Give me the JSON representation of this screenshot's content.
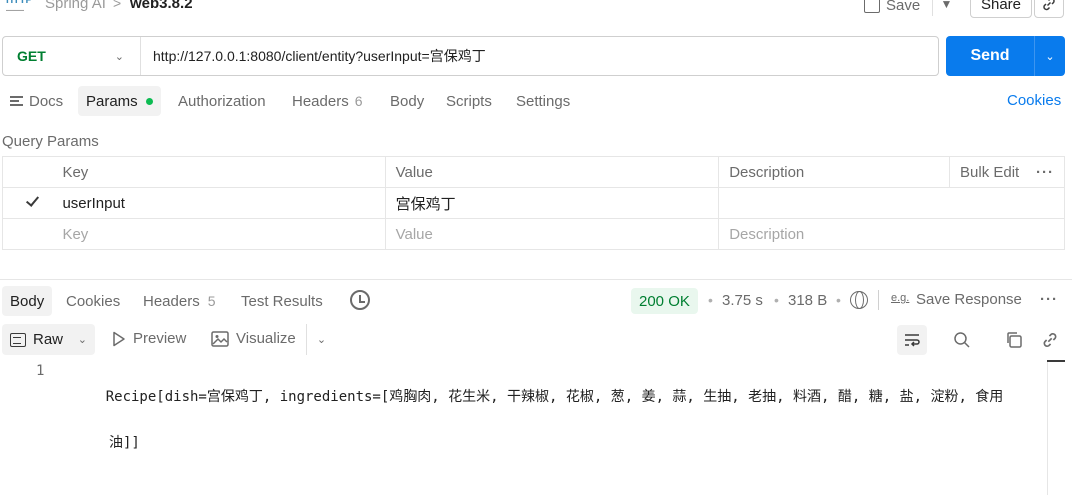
{
  "breadcrumb": {
    "parent": "Spring AI",
    "separator": ">",
    "current": "web3.8.2"
  },
  "header_actions": {
    "save_label": "Save",
    "share_label": "Share"
  },
  "request": {
    "method": "GET",
    "url": "http://127.0.0.1:8080/client/entity?userInput=宫保鸡丁",
    "send_label": "Send"
  },
  "request_tabs": [
    {
      "label": "Docs"
    },
    {
      "label": "Params",
      "active": true
    },
    {
      "label": "Authorization"
    },
    {
      "label": "Headers",
      "count": "6"
    },
    {
      "label": "Body"
    },
    {
      "label": "Scripts"
    },
    {
      "label": "Settings"
    }
  ],
  "cookies_link": "Cookies",
  "query_params": {
    "title": "Query Params",
    "columns": [
      "Key",
      "Value",
      "Description"
    ],
    "bulk_edit": "Bulk Edit",
    "rows": [
      {
        "checked": true,
        "key": "userInput",
        "value": "宫保鸡丁",
        "description": ""
      }
    ],
    "placeholder": {
      "key": "Key",
      "value": "Value",
      "description": "Description"
    }
  },
  "response_tabs": [
    {
      "label": "Body",
      "active": true
    },
    {
      "label": "Cookies"
    },
    {
      "label": "Headers",
      "count": "5"
    },
    {
      "label": "Test Results"
    }
  ],
  "response_meta": {
    "status": "200 OK",
    "time": "3.75 s",
    "size": "318 B",
    "save_response": "Save Response"
  },
  "response_toolbar": {
    "format": "Raw",
    "preview": "Preview",
    "visualize": "Visualize"
  },
  "response_body": {
    "line_number": "1",
    "line1": "Recipe[dish=宫保鸡丁, ingredients=[鸡胸肉, 花生米, 干辣椒, 花椒, 葱, 姜, 蒜, 生抽, 老抽, 料酒, 醋, 糖, 盐, 淀粉, 食用",
    "line1_cont": "油]]"
  },
  "colors": {
    "accent": "#097bed",
    "method_get": "#007f31",
    "status_ok_bg": "#e9f7ee",
    "params_dot": "#0cbb52"
  }
}
